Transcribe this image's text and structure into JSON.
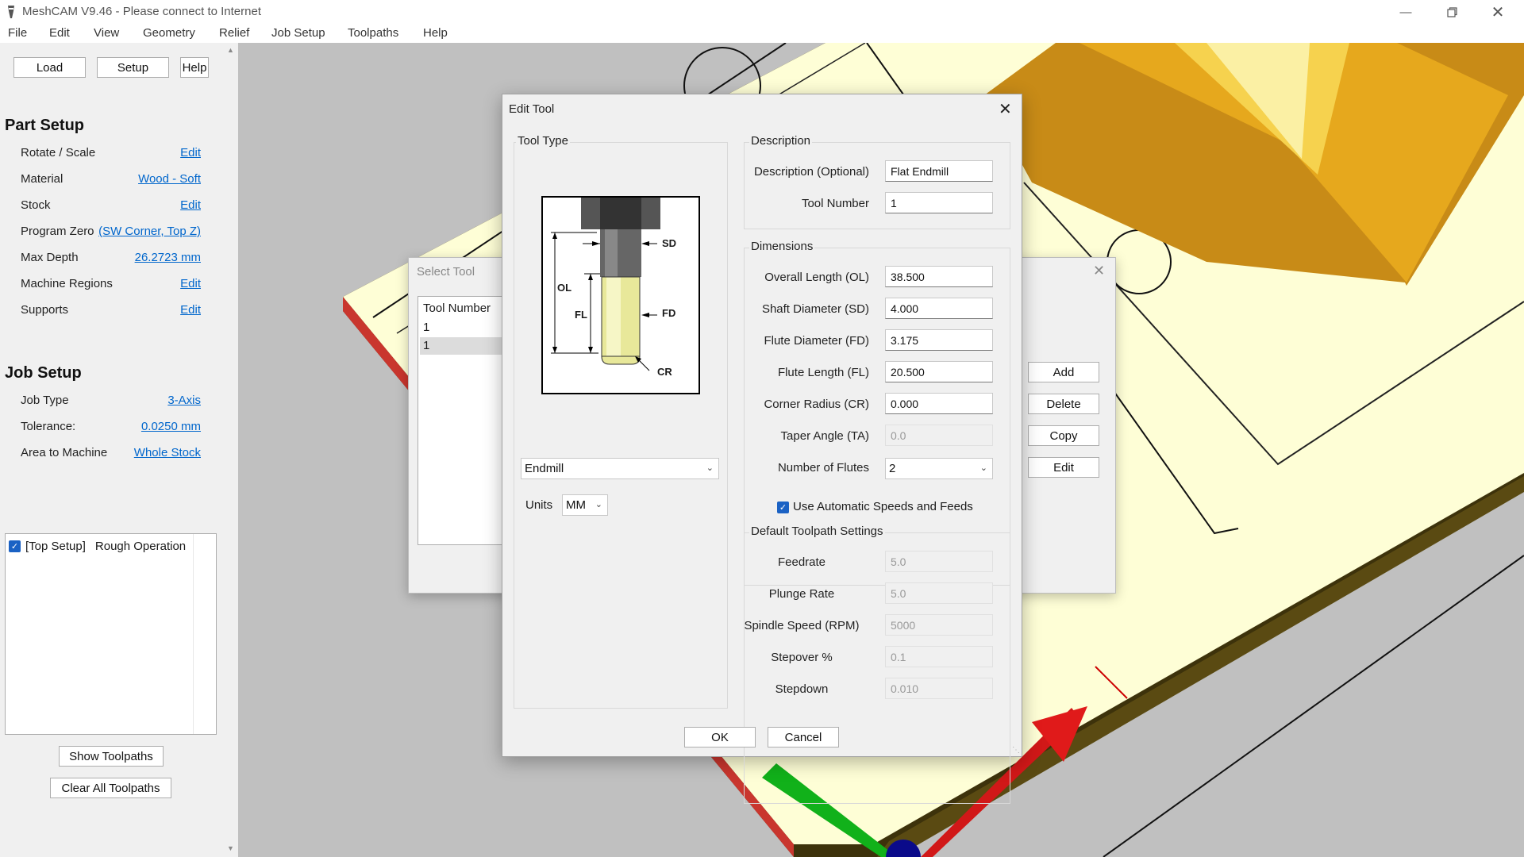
{
  "window": {
    "title": "MeshCAM V9.46 - Please connect to Internet",
    "min_icon": "minimize-icon",
    "max_icon": "restore-icon",
    "close_icon": "close-icon"
  },
  "menu": [
    "File",
    "Edit",
    "View",
    "Geometry",
    "Relief",
    "Job Setup",
    "Toolpaths",
    "Help"
  ],
  "sidebar": {
    "buttons": {
      "load": "Load",
      "setup": "Setup",
      "help": "Help"
    },
    "part_setup": {
      "title": "Part Setup",
      "rows": [
        {
          "label": "Rotate / Scale",
          "value": "Edit"
        },
        {
          "label": "Material",
          "value": "Wood - Soft"
        },
        {
          "label": "Stock",
          "value": "Edit"
        },
        {
          "label": "Program Zero",
          "value": "(SW Corner, Top Z)"
        },
        {
          "label": "Max Depth",
          "value": "26.2723 mm"
        },
        {
          "label": "Machine Regions",
          "value": "Edit"
        },
        {
          "label": "Supports",
          "value": "Edit"
        }
      ]
    },
    "job_setup": {
      "title": "Job Setup",
      "rows": [
        {
          "label": "Job Type",
          "value": "3-Axis"
        },
        {
          "label": "Tolerance:",
          "value": "0.0250 mm"
        },
        {
          "label": "Area to Machine",
          "value": "Whole Stock"
        }
      ]
    },
    "operations": [
      {
        "checked": true,
        "setup": "[Top Setup]",
        "name": "Rough Operation"
      }
    ],
    "show_toolpaths": "Show Toolpaths",
    "clear_toolpaths": "Clear All Toolpaths"
  },
  "select_tool": {
    "title": "Select Tool",
    "column": "Tool Number",
    "rows": [
      "1",
      "1"
    ],
    "buttons": {
      "add": "Add",
      "delete": "Delete",
      "copy": "Copy",
      "edit": "Edit"
    }
  },
  "edit_tool": {
    "title": "Edit Tool",
    "tool_type": {
      "title": "Tool Type",
      "diagram_labels": {
        "sd": "SD",
        "ol": "OL",
        "fl": "FL",
        "fd": "FD",
        "cr": "CR"
      },
      "type": "Endmill",
      "units_label": "Units",
      "units": "MM"
    },
    "description": {
      "title": "Description",
      "desc_label": "Description (Optional)",
      "desc_value": "Flat Endmill",
      "num_label": "Tool Number",
      "num_value": "1"
    },
    "dimensions": {
      "title": "Dimensions",
      "fields": [
        {
          "label": "Overall Length (OL)",
          "value": "38.500"
        },
        {
          "label": "Shaft Diameter (SD)",
          "value": "4.000"
        },
        {
          "label": "Flute Diameter (FD)",
          "value": "3.175"
        },
        {
          "label": "Flute Length (FL)",
          "value": "20.500"
        },
        {
          "label": "Corner Radius (CR)",
          "value": "0.000"
        },
        {
          "label": "Taper Angle (TA)",
          "value": "0.0"
        }
      ],
      "flutes_label": "Number of Flutes",
      "flutes_value": "2"
    },
    "auto_speeds": {
      "label": "Use Automatic Speeds and Feeds",
      "checked": true
    },
    "defaults": {
      "title": "Default Toolpath Settings",
      "fields": [
        {
          "label": "Feedrate",
          "value": "5.0"
        },
        {
          "label": "Plunge Rate",
          "value": "5.0"
        },
        {
          "label": "Spindle Speed (RPM)",
          "value": "5000"
        },
        {
          "label": "Stepover %",
          "value": "0.1"
        },
        {
          "label": "Stepdown",
          "value": "0.010"
        }
      ]
    },
    "ok": "OK",
    "cancel": "Cancel"
  }
}
